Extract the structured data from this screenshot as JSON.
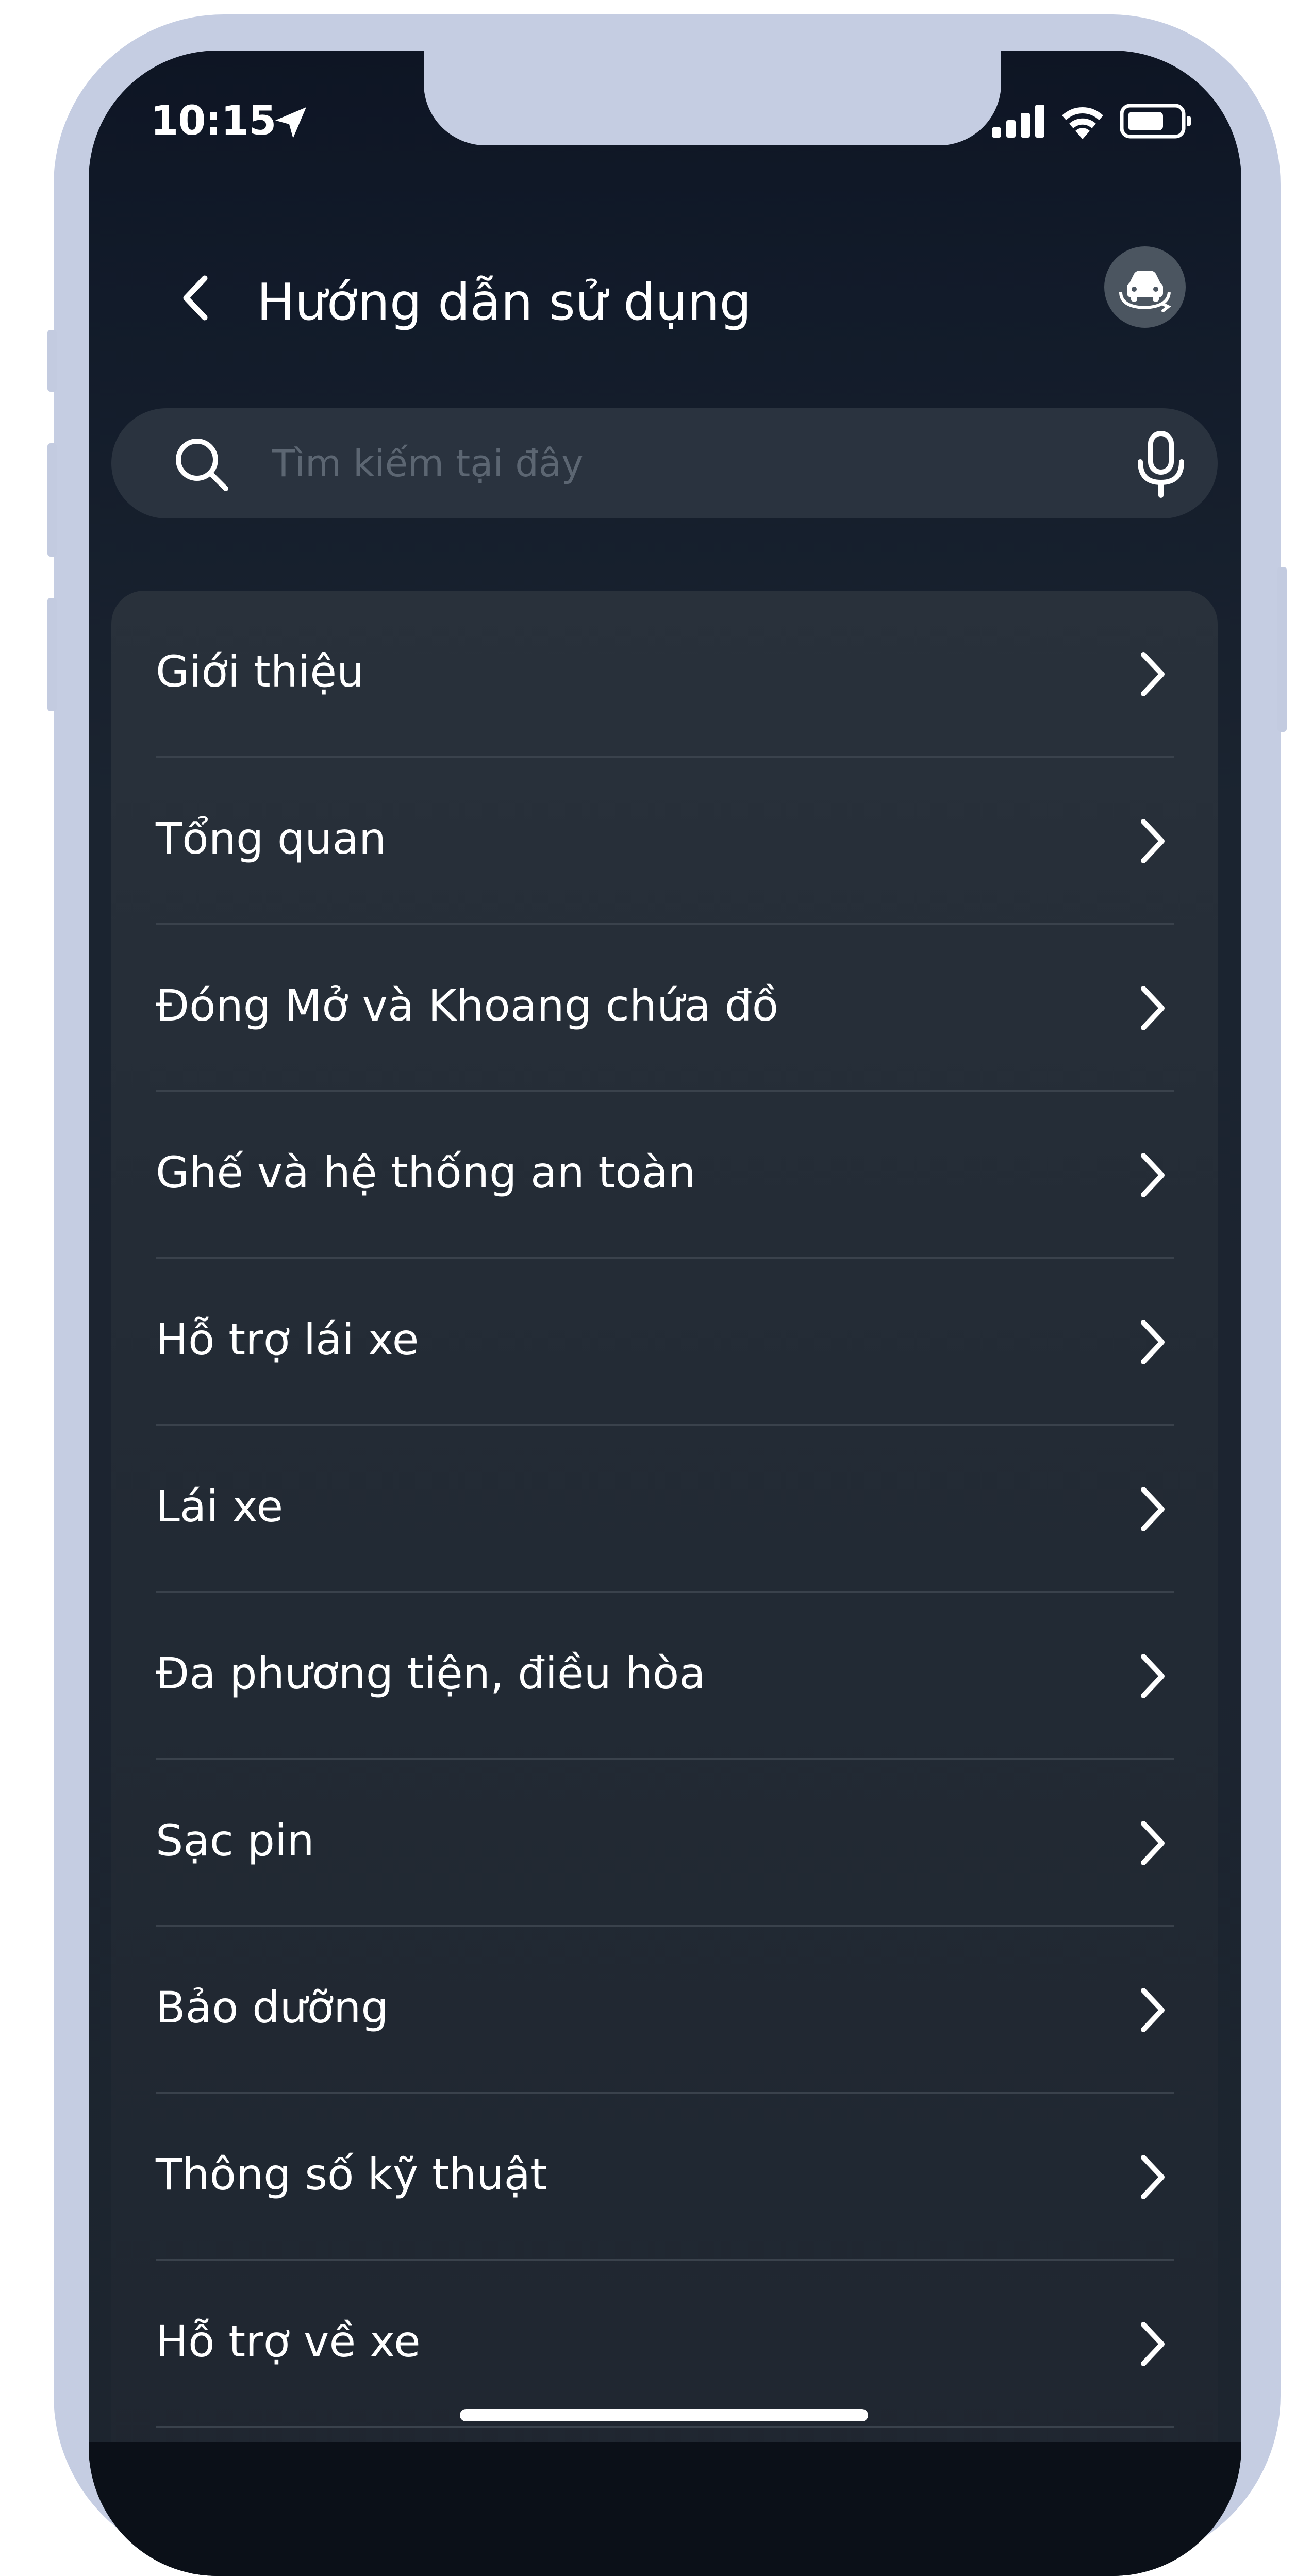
{
  "status_bar": {
    "time": "10:15",
    "icons": [
      "location-arrow-icon",
      "cellular-signal-icon",
      "wifi-icon",
      "battery-icon"
    ]
  },
  "header": {
    "back_icon": "chevron-left-icon",
    "title": "Hướng dẫn sử dụng",
    "car_icon": "car-rotate-icon"
  },
  "search": {
    "placeholder": "Tìm kiếm tại đây",
    "value": "",
    "icon": "search-icon",
    "voice_icon": "microphone-icon"
  },
  "menu": {
    "items": [
      {
        "label": "Giới thiệu"
      },
      {
        "label": "Tổng quan"
      },
      {
        "label": "Đóng Mở và Khoang chứa đồ"
      },
      {
        "label": "Ghế và hệ thống an toàn"
      },
      {
        "label": "Hỗ trợ lái xe"
      },
      {
        "label": "Lái xe"
      },
      {
        "label": "Đa phương tiện, điều hòa"
      },
      {
        "label": "Sạc pin"
      },
      {
        "label": "Bảo dưỡng"
      },
      {
        "label": "Thông số kỹ thuật"
      },
      {
        "label": "Hỗ trợ về xe"
      }
    ]
  },
  "colors": {
    "background_top": "#0e1524",
    "background_bottom": "#1d252f",
    "card": "#29313b",
    "search_bg": "#2a333f",
    "frame": "#c5cde2",
    "text": "#ffffff",
    "placeholder": "#5c6672"
  }
}
